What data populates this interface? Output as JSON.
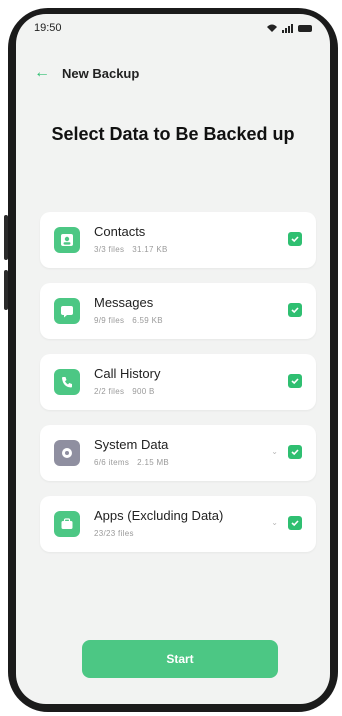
{
  "status_bar": {
    "time": "19:50"
  },
  "header": {
    "back_icon": "arrow-left-icon",
    "title": "New Backup"
  },
  "page_title": "Select Data to Be Backed up",
  "items": [
    {
      "label": "Contacts",
      "count": "3/3 files",
      "size": "31.17 KB",
      "icon": "contact-card-icon",
      "icon_color": "#4cc784",
      "checked": true,
      "expandable": false
    },
    {
      "label": "Messages",
      "count": "9/9 files",
      "size": "6.59 KB",
      "icon": "message-icon",
      "icon_color": "#4cc784",
      "checked": true,
      "expandable": false
    },
    {
      "label": "Call History",
      "count": "2/2 files",
      "size": "900 B",
      "icon": "phone-icon",
      "icon_color": "#4cc784",
      "checked": true,
      "expandable": false
    },
    {
      "label": "System Data",
      "count": "6/6 items",
      "size": "2.15 MB",
      "icon": "system-icon",
      "icon_color": "#8f8fa0",
      "checked": true,
      "expandable": true
    },
    {
      "label": "Apps (Excluding Data)",
      "count": "23/23 files",
      "size": "",
      "icon": "apps-icon",
      "icon_color": "#4cc784",
      "checked": true,
      "expandable": true
    }
  ],
  "start_button": {
    "label": "Start"
  },
  "colors": {
    "accent": "#2fbf71",
    "button": "#4cc784"
  }
}
